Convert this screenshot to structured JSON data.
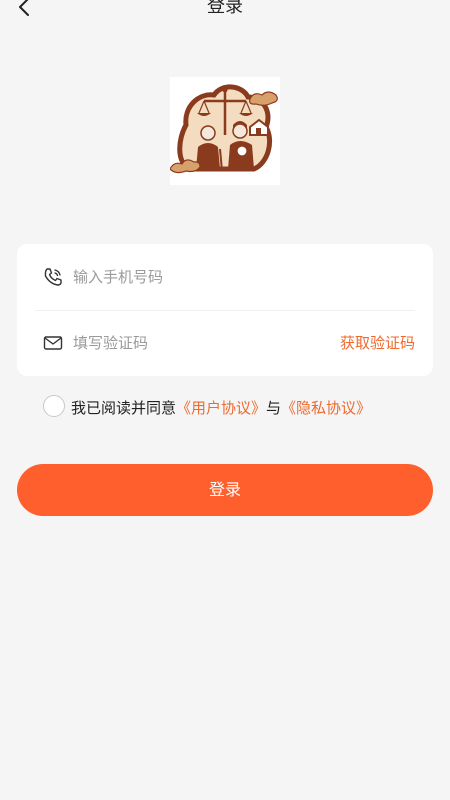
{
  "header": {
    "title": "登录"
  },
  "logo": {
    "icon": "family-law-scale-logo",
    "colors": {
      "primary": "#8a3b1e",
      "cloud": "#c08a4a",
      "bg": "#ffffff"
    }
  },
  "form": {
    "phone": {
      "placeholder": "输入手机号码",
      "value": "",
      "icon": "phone-icon"
    },
    "code": {
      "placeholder": "填写验证码",
      "value": "",
      "icon": "mail-icon",
      "get_code_label": "获取验证码"
    }
  },
  "agreement": {
    "checked": false,
    "prefix": "我已阅读并同意",
    "user_agreement": "《用户协议》",
    "conjunction": "与",
    "privacy_policy": "《隐私协议》"
  },
  "actions": {
    "login_label": "登录"
  },
  "theme": {
    "accent": "#ee6a2f",
    "button": "#ff5f2c",
    "background": "#f5f5f5"
  }
}
